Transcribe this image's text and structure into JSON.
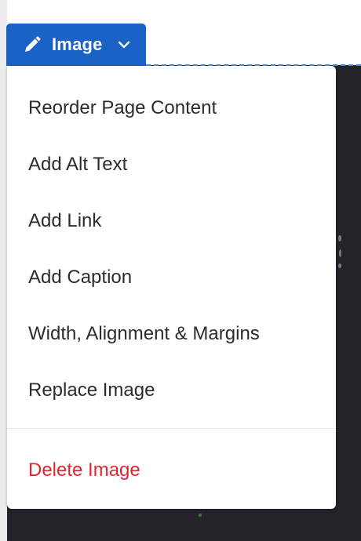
{
  "block_chip": {
    "label": "Image",
    "icon": "pencil-icon",
    "dropdown_icon": "chevron-down-icon",
    "background": "#1b62c7"
  },
  "menu": {
    "items": [
      {
        "label": "Reorder Page Content"
      },
      {
        "label": "Add Alt Text"
      },
      {
        "label": "Add Link"
      },
      {
        "label": "Add Caption"
      },
      {
        "label": "Width, Alignment & Margins"
      },
      {
        "label": "Replace Image"
      }
    ],
    "danger_item": {
      "label": "Delete Image",
      "color": "#e0262c"
    }
  }
}
